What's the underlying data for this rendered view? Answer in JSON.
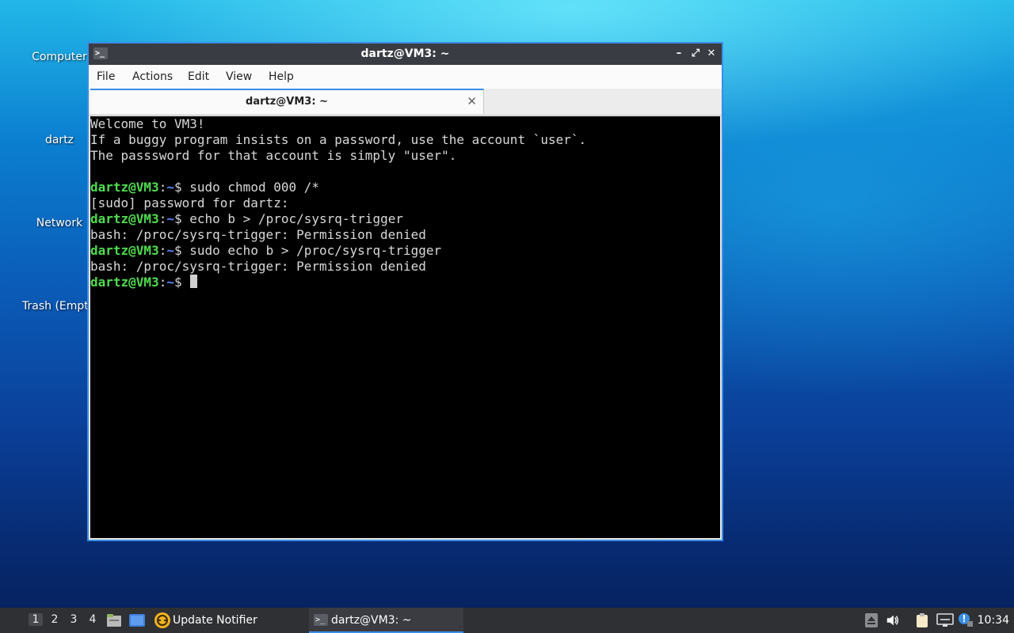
{
  "desktop": {
    "icons": [
      {
        "label": "Computer"
      },
      {
        "label": "dartz"
      },
      {
        "label": "Network"
      },
      {
        "label": "Trash (Empt"
      }
    ]
  },
  "window": {
    "title": "dartz@VM3: ~",
    "controls": {
      "minimize": "–",
      "maximize": "⤢",
      "close": "✕"
    },
    "menu": [
      "File",
      "Actions",
      "Edit",
      "View",
      "Help"
    ],
    "tab": {
      "label": "dartz@VM3: ~",
      "close": "✕"
    }
  },
  "terminal": {
    "prompt_user": "dartz@VM3",
    "prompt_colon": ":",
    "prompt_path": "~",
    "prompt_symbol": "$ ",
    "lines": [
      {
        "text": "Welcome to VM3!"
      },
      {
        "text": "If a buggy program insists on a password, use the account `user`."
      },
      {
        "text": "The passsword for that account is simply \"user\"."
      },
      {
        "text": ""
      },
      {
        "command": "sudo chmod 000 /*"
      },
      {
        "text": "[sudo] password for dartz:"
      },
      {
        "command": "echo b > /proc/sysrq-trigger"
      },
      {
        "text": "bash: /proc/sysrq-trigger: Permission denied"
      },
      {
        "command": "sudo echo b > /proc/sysrq-trigger"
      },
      {
        "text": "bash: /proc/sysrq-trigger: Permission denied"
      },
      {
        "command": ""
      }
    ]
  },
  "taskbar": {
    "workspaces": [
      "1",
      "2",
      "3",
      "4"
    ],
    "active_workspace": "1",
    "tasks": [
      {
        "label": "Update Notifier"
      },
      {
        "label": "dartz@VM3: ~"
      }
    ],
    "clock": "10:34"
  },
  "colors": {
    "prompt_user": "#4fdc4f",
    "prompt_path": "#5b8bff",
    "accent": "#3a8ee6"
  }
}
